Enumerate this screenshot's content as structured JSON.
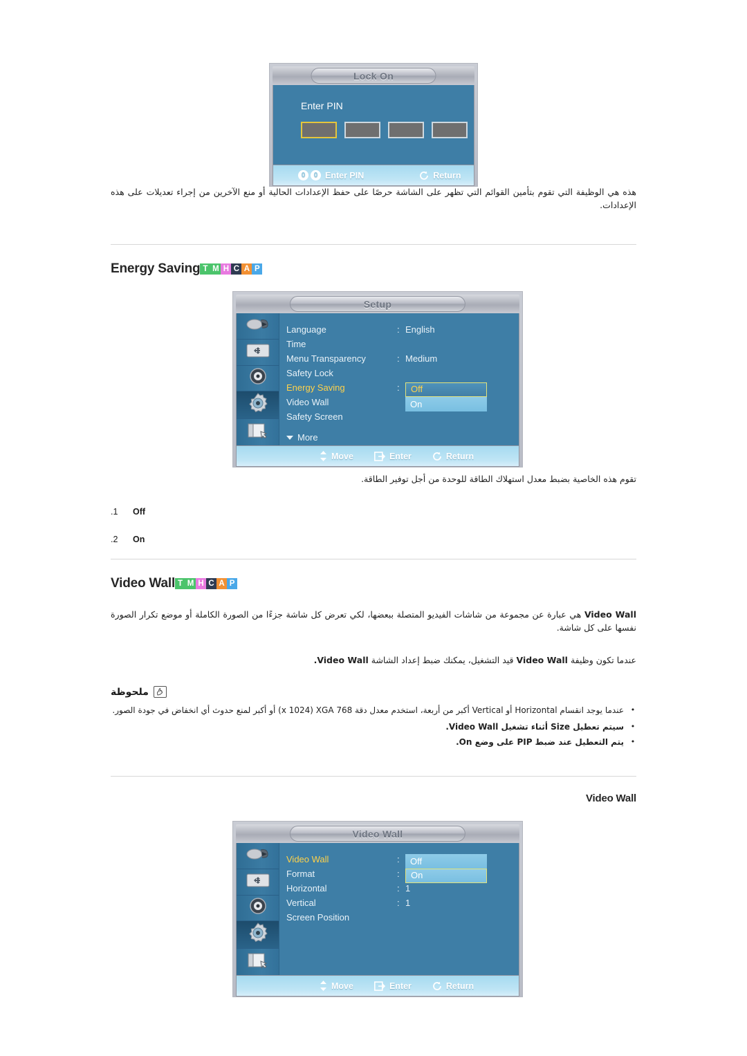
{
  "lock_dialog": {
    "title": "Lock On",
    "prompt": "Enter PIN",
    "pin_boxes": [
      "",
      "",
      "",
      ""
    ],
    "footer": [
      {
        "icon": "numeric-keys-icon",
        "label": "Enter PIN"
      },
      {
        "icon": "return-arrow-icon",
        "label": "Return"
      }
    ]
  },
  "safety_lock_desc": "هذه هي الوظيفة التي تقوم بتأمين القوائم التي تظهر على الشاشة حرصًا على حفظ الإعدادات الحالية أو منع الآخرين من إجراء تعديلات على هذه الإعدادات.",
  "tags": [
    {
      "letter": "T",
      "color": "#4bc46b"
    },
    {
      "letter": "M",
      "color": "#4bc46b"
    },
    {
      "letter": "H",
      "color": "#e87ae0"
    },
    {
      "letter": "C",
      "color": "#2f3b52"
    },
    {
      "letter": "A",
      "color": "#f29033"
    },
    {
      "letter": "P",
      "color": "#4aa8e8"
    }
  ],
  "energy_saving": {
    "heading": "Energy Saving",
    "osd": {
      "title": "Setup",
      "rows": [
        {
          "label": "Language",
          "value": "English",
          "selected": false,
          "has_value": true
        },
        {
          "label": "Time",
          "value": "",
          "selected": false,
          "has_value": false
        },
        {
          "label": "Menu Transparency",
          "value": "Medium",
          "selected": false,
          "has_value": true
        },
        {
          "label": "Safety Lock",
          "value": "",
          "selected": false,
          "has_value": false
        },
        {
          "label": "Energy Saving",
          "value": "",
          "selected": true,
          "has_value": false
        },
        {
          "label": "Video Wall",
          "value": "",
          "selected": false,
          "has_value": false
        },
        {
          "label": "Safety Screen",
          "value": "",
          "selected": false,
          "has_value": false
        }
      ],
      "more_label": "More",
      "dropdown": {
        "options": [
          "Off",
          "On"
        ],
        "highlighted": "Off",
        "selected": "On"
      },
      "footer": [
        {
          "icon": "move-updown-icon",
          "label": "Move"
        },
        {
          "icon": "enter-icon",
          "label": "Enter"
        },
        {
          "icon": "return-arrow-icon",
          "label": "Return"
        }
      ],
      "rail_icons": [
        "input-icon",
        "picture-adjust-icon",
        "sound-icon",
        "setup-gear-icon",
        "multi-control-icon"
      ],
      "active_rail_index": 3
    },
    "desc": "تقوم هذه الخاصية بضبط معدل استهلاك الطاقة للوحدة من أجل توفير الطاقة.",
    "options": [
      {
        "num": ".1",
        "label": "Off"
      },
      {
        "num": ".2",
        "label": "On"
      }
    ]
  },
  "video_wall": {
    "heading": "Video Wall",
    "desc1_prefix": "Video Wall",
    "desc1": " هي عبارة عن مجموعة من شاشات الفيديو المتصلة ببعضها، لكي تعرض كل شاشة جزءًا من الصورة الكاملة أو موضع تكرار الصورة نفسها على كل شاشة.",
    "desc2_a": "عندما تكون وظيفة ",
    "desc2_b": "Video Wall",
    "desc2_c": " قيد التشغيل، يمكنك ضبط إعداد الشاشة ",
    "desc2_d": "Video Wall",
    "desc2_e": ".",
    "note_title": "ملحوظة",
    "note_icon": "note-hand-icon",
    "notes": [
      "عندما يوجد انقسام Horizontal أو Vertical أكبر من أربعة، استخدم معدل دقة 768 x 1024) XGA) أو أكبر لمنع حدوث أي انخفاض في جودة الصور.",
      "سيتم تعطيل Size أثناء تشغيل Video Wall.",
      "يتم التعطيل عند ضبط PIP على وضع On."
    ],
    "sub_heading": "Video Wall",
    "osd": {
      "title": "Video Wall",
      "rows": [
        {
          "label": "Video Wall",
          "value": "",
          "selected": true,
          "has_value": false
        },
        {
          "label": "Format",
          "value": "",
          "selected": false,
          "has_value": false
        },
        {
          "label": "Horizontal",
          "value": "1",
          "selected": false,
          "has_value": true
        },
        {
          "label": "Vertical",
          "value": "1",
          "selected": false,
          "has_value": true
        },
        {
          "label": "Screen Position",
          "value": "",
          "selected": false,
          "has_value": false
        }
      ],
      "dropdown": {
        "options": [
          "Off",
          "On"
        ],
        "highlighted": "On",
        "selected": "Off"
      },
      "footer": [
        {
          "icon": "move-updown-icon",
          "label": "Move"
        },
        {
          "icon": "enter-icon",
          "label": "Enter"
        },
        {
          "icon": "return-arrow-icon",
          "label": "Return"
        }
      ],
      "rail_icons": [
        "input-icon",
        "picture-adjust-icon",
        "sound-icon",
        "setup-gear-icon",
        "multi-control-icon"
      ],
      "active_rail_index": 3
    }
  }
}
